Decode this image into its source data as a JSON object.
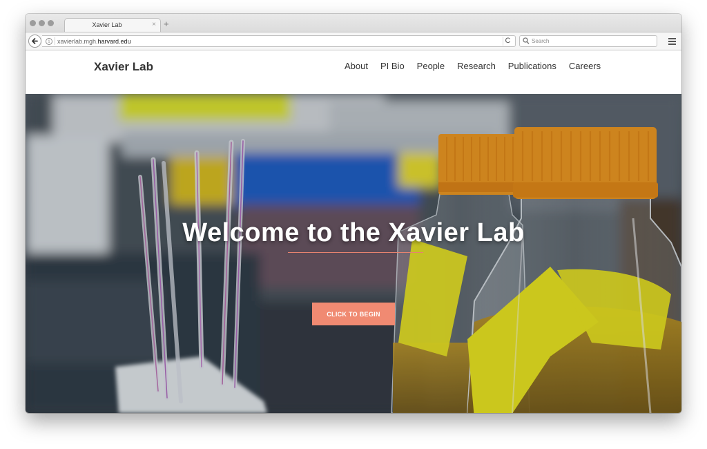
{
  "browser": {
    "tab_title": "Xavier Lab",
    "tab_close": "×",
    "new_tab": "+",
    "url_prefix": "xavierlab.mgh.",
    "url_domain": "harvard.edu",
    "reload": "C",
    "search_placeholder": "Search"
  },
  "site": {
    "brand": "Xavier Lab",
    "nav": [
      "About",
      "PI Bio",
      "People",
      "Research",
      "Publications",
      "Careers"
    ]
  },
  "hero": {
    "title": "Welcome to the Xavier Lab",
    "cta_label": "CLICK TO BEGIN"
  },
  "colors": {
    "accent": "#f08a72",
    "cap_orange": "#f4941a",
    "label_yellow": "#f2ec1a",
    "liquid_amber": "#b9890f"
  },
  "icons": [
    "back-arrow-icon",
    "info-icon",
    "reload-icon",
    "search-icon",
    "hamburger-menu-icon"
  ]
}
